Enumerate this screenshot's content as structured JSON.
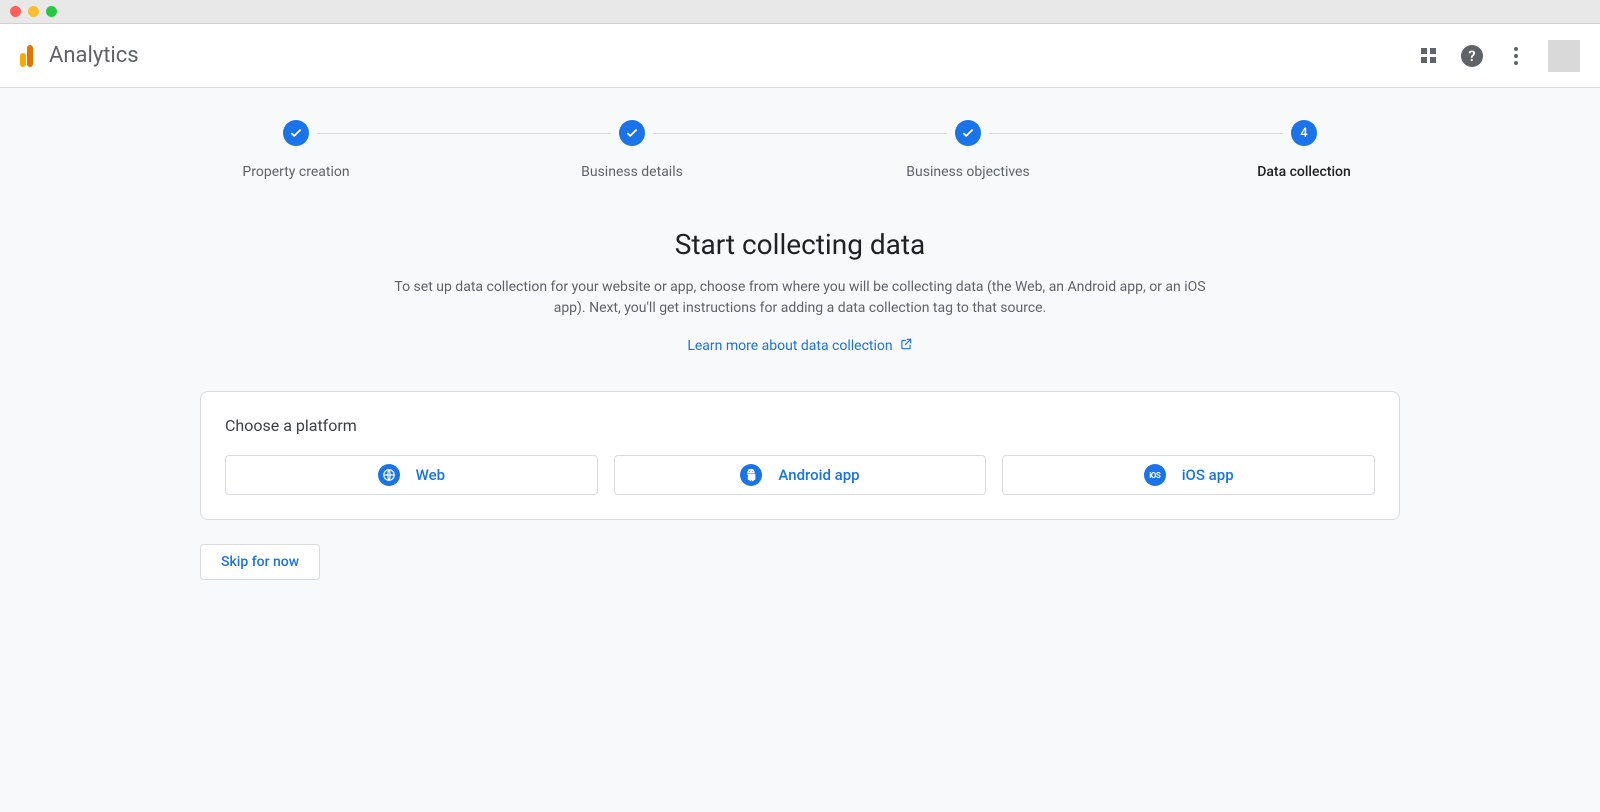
{
  "header": {
    "app_title": "Analytics"
  },
  "stepper": {
    "steps": [
      {
        "label": "Property creation",
        "state": "done"
      },
      {
        "label": "Business details",
        "state": "done"
      },
      {
        "label": "Business objectives",
        "state": "done"
      },
      {
        "label": "Data collection",
        "state": "active",
        "number": "4"
      }
    ]
  },
  "main": {
    "headline": "Start collecting data",
    "subtext": "To set up data collection for your website or app, choose from where you will be collecting data (the Web, an Android app, or an iOS app). Next, you'll get instructions for adding a data collection tag to that source.",
    "learn_more": "Learn more about data collection"
  },
  "platform_card": {
    "title": "Choose a platform",
    "options": [
      {
        "label": "Web",
        "icon": "globe"
      },
      {
        "label": "Android app",
        "icon": "android"
      },
      {
        "label": "iOS app",
        "icon": "ios"
      }
    ]
  },
  "actions": {
    "skip": "Skip for now"
  },
  "colors": {
    "primary": "#1a73e8",
    "text_secondary": "#5f6368",
    "text_primary": "#202124",
    "border": "#dadce0",
    "surface": "#f8f9fa"
  }
}
